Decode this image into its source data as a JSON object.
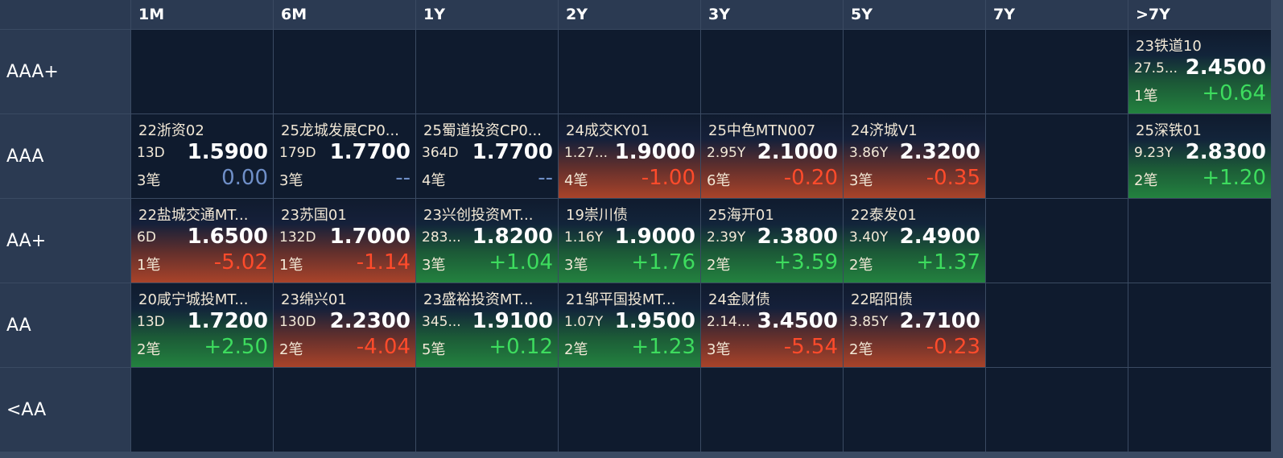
{
  "colors": {
    "up": "#3ddc5e",
    "down": "#ff4b2b",
    "flat": "#6f8fc8",
    "header_bg": "#2b3a52",
    "cell_bg": "#0f1b2e"
  },
  "columns": [
    "1M",
    "6M",
    "1Y",
    "2Y",
    "3Y",
    "5Y",
    "7Y",
    ">7Y"
  ],
  "rows": [
    {
      "label": "AAA+",
      "cells": [
        null,
        null,
        null,
        null,
        null,
        null,
        null,
        {
          "name": "23铁道10",
          "tenor": "27.5...",
          "yield": "2.4500",
          "count": "1笔",
          "change": "+0.64",
          "trend": "green"
        }
      ]
    },
    {
      "label": "AAA",
      "cells": [
        {
          "name": "22浙资02",
          "tenor": "13D",
          "yield": "1.5900",
          "count": "3笔",
          "change": "0.00",
          "trend": "neutral"
        },
        {
          "name": "25龙城发展CP0...",
          "tenor": "179D",
          "yield": "1.7700",
          "count": "3笔",
          "change": "--",
          "trend": "neutral"
        },
        {
          "name": "25蜀道投资CP0...",
          "tenor": "364D",
          "yield": "1.7700",
          "count": "4笔",
          "change": "--",
          "trend": "neutral"
        },
        {
          "name": "24成交KY01",
          "tenor": "1.27...",
          "yield": "1.9000",
          "count": "4笔",
          "change": "-1.00",
          "trend": "red"
        },
        {
          "name": "25中色MTN007",
          "tenor": "2.95Y",
          "yield": "2.1000",
          "count": "6笔",
          "change": "-0.20",
          "trend": "red"
        },
        {
          "name": "24济城V1",
          "tenor": "3.86Y",
          "yield": "2.3200",
          "count": "3笔",
          "change": "-0.35",
          "trend": "red"
        },
        null,
        {
          "name": "25深铁01",
          "tenor": "9.23Y",
          "yield": "2.8300",
          "count": "2笔",
          "change": "+1.20",
          "trend": "green"
        }
      ]
    },
    {
      "label": "AA+",
      "cells": [
        {
          "name": "22盐城交通MT...",
          "tenor": "6D",
          "yield": "1.6500",
          "count": "1笔",
          "change": "-5.02",
          "trend": "red"
        },
        {
          "name": "23苏国01",
          "tenor": "132D",
          "yield": "1.7000",
          "count": "1笔",
          "change": "-1.14",
          "trend": "red"
        },
        {
          "name": "23兴创投资MT...",
          "tenor": "283...",
          "yield": "1.8200",
          "count": "3笔",
          "change": "+1.04",
          "trend": "green"
        },
        {
          "name": "19崇川债",
          "tenor": "1.16Y",
          "yield": "1.9000",
          "count": "3笔",
          "change": "+1.76",
          "trend": "green"
        },
        {
          "name": "25海开01",
          "tenor": "2.39Y",
          "yield": "2.3800",
          "count": "2笔",
          "change": "+3.59",
          "trend": "green"
        },
        {
          "name": "22泰发01",
          "tenor": "3.40Y",
          "yield": "2.4900",
          "count": "2笔",
          "change": "+1.37",
          "trend": "green"
        },
        null,
        null
      ]
    },
    {
      "label": "AA",
      "cells": [
        {
          "name": "20咸宁城投MT...",
          "tenor": "13D",
          "yield": "1.7200",
          "count": "2笔",
          "change": "+2.50",
          "trend": "green"
        },
        {
          "name": "23绵兴01",
          "tenor": "130D",
          "yield": "2.2300",
          "count": "2笔",
          "change": "-4.04",
          "trend": "red"
        },
        {
          "name": "23盛裕投资MT...",
          "tenor": "345...",
          "yield": "1.9100",
          "count": "5笔",
          "change": "+0.12",
          "trend": "green"
        },
        {
          "name": "21邹平国投MT...",
          "tenor": "1.07Y",
          "yield": "1.9500",
          "count": "2笔",
          "change": "+1.23",
          "trend": "green"
        },
        {
          "name": "24金财债",
          "tenor": "2.14...",
          "yield": "3.4500",
          "count": "3笔",
          "change": "-5.54",
          "trend": "red"
        },
        {
          "name": "22昭阳债",
          "tenor": "3.85Y",
          "yield": "2.7100",
          "count": "2笔",
          "change": "-0.23",
          "trend": "red"
        },
        null,
        null
      ]
    },
    {
      "label": "<AA",
      "cells": [
        null,
        null,
        null,
        null,
        null,
        null,
        null,
        null
      ]
    }
  ]
}
